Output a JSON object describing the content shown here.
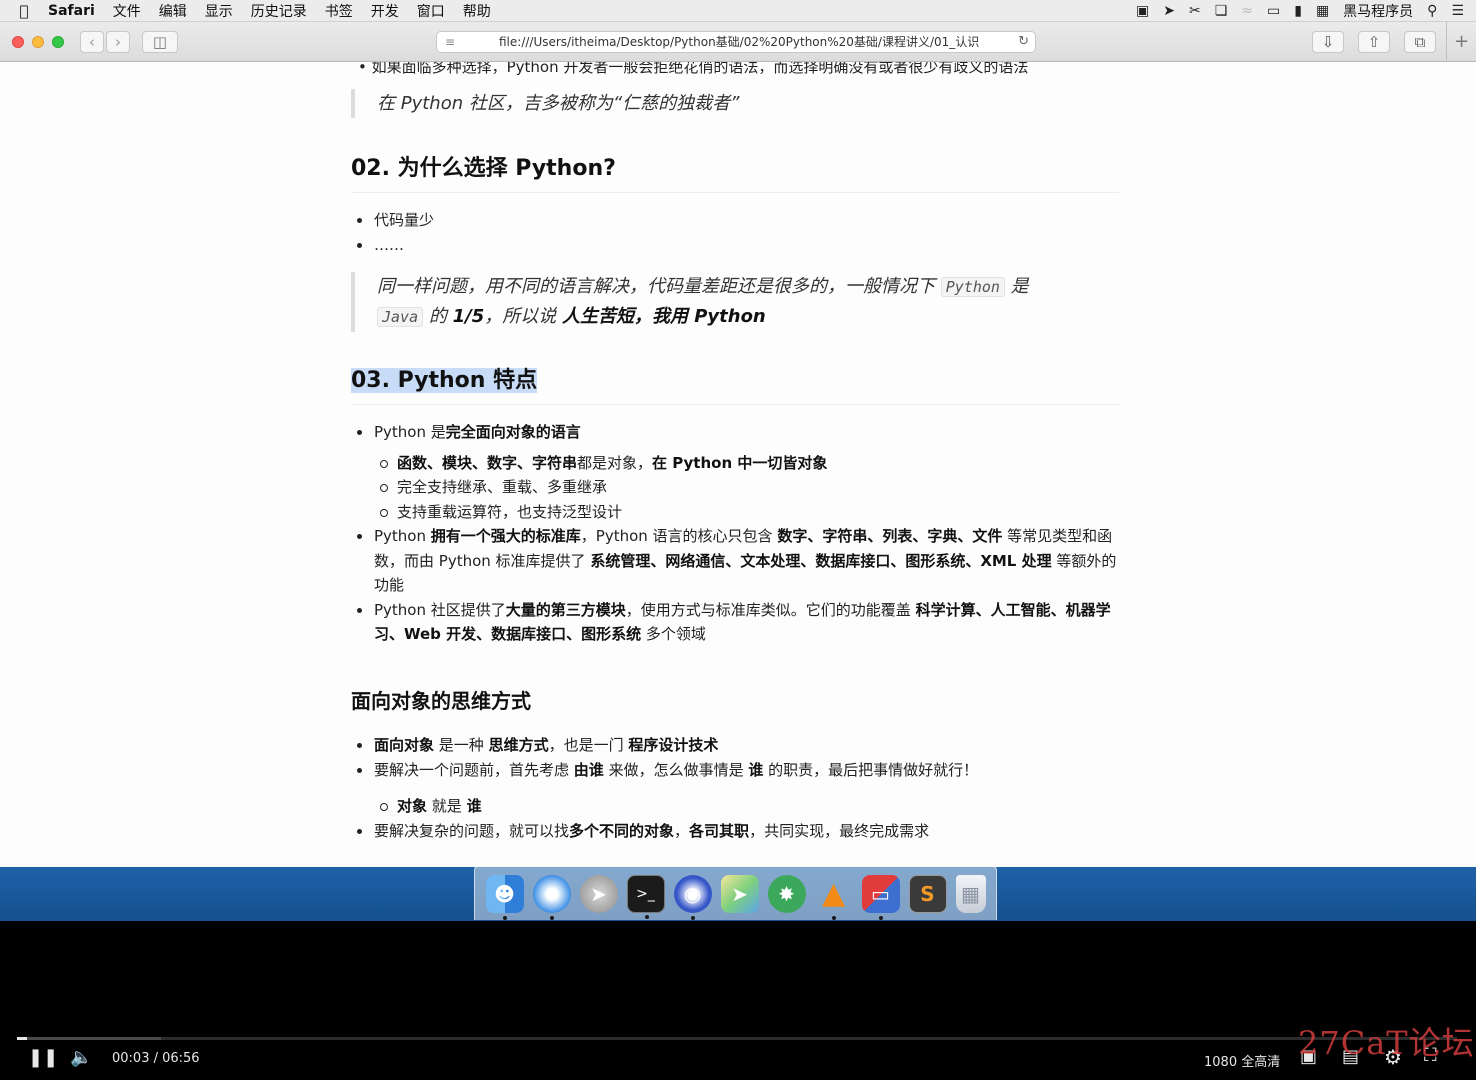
{
  "menubar": {
    "apple": "",
    "app_name": "Safari",
    "items": [
      "文件",
      "编辑",
      "显示",
      "历史记录",
      "书签",
      "开发",
      "窗口",
      "帮助"
    ],
    "user_name": "黑马程序员"
  },
  "browser": {
    "url": "file:///Users/itheima/Desktop/Python基础/02%20Python%20基础/课程讲义/01_认识",
    "new_tab": "+"
  },
  "doc": {
    "cut_line": "如果面临多种选择，Python 开发者一般会拒绝花俏的语法，而选择明确没有或者很少有歧义的语法",
    "quote1": "在 Python 社区，吉多被称为“仁慈的独裁者”",
    "h2_why": "02. 为什么选择 Python?",
    "why_items": [
      "代码量少",
      "……"
    ],
    "quote2": {
      "p1": "同一样问题，用不同的语言解决，代码量差距还是很多的，一般情况下",
      "code1": "Python",
      "p2": "是",
      "code2": "Java",
      "p3": "的",
      "b1": "1/5",
      "p4": "，所以说",
      "b2": "人生苦短，我用 Python"
    },
    "h2_features": "03. Python 特点",
    "f1": {
      "a": "Python 是",
      "b": "完全面向对象的语言"
    },
    "f1_sub1": {
      "b1": "函数、模块、数字、字符串",
      "a1": "都是对象，",
      "b2": "在 Python 中一切皆对象"
    },
    "f1_sub2": "完全支持继承、重载、多重继承",
    "f1_sub3": "支持重载运算符，也支持泛型设计",
    "f2": {
      "a": "Python ",
      "b1": "拥有一个强大的标准库",
      "c": "，Python 语言的核心只包含 ",
      "b2": "数字、字符串、列表、字典、文件",
      "d": " 等常见类型和函数，而由 Python 标准库提供了 ",
      "b3": "系统管理、网络通信、文本处理、数据库接口、图形系统、XML 处理",
      "e": " 等额外的功能"
    },
    "f3": {
      "a": "Python 社区提供了",
      "b1": "大量的第三方模块",
      "c": "，使用方式与标准库类似。它们的功能覆盖 ",
      "b2": "科学计算、人工智能、机器学习、Web 开发、数据库接口、图形系统",
      "d": " 多个领域"
    },
    "h3_oop": "面向对象的思维方式",
    "o1": {
      "b1": "面向对象",
      "a": " 是一种 ",
      "b2": "思维方式",
      "c": "，也是一门 ",
      "b3": "程序设计技术"
    },
    "o2": {
      "a": "要解决一个问题前，首先考虑 ",
      "b1": "由谁",
      "c": " 来做，怎么做事情是 ",
      "b2": "谁",
      "d": " 的职责，最后把事情做好就行！"
    },
    "o2_sub": {
      "b1": "对象",
      "a": " 就是 ",
      "b2": "谁"
    },
    "o3": {
      "a": "要解决复杂的问题，就可以找",
      "b1": "多个不同的对象",
      "c": "，",
      "b2": "各司其职",
      "d": "，共同实现，最终完成需求"
    }
  },
  "dock": {
    "icons": [
      "finder-icon",
      "safari-icon",
      "launchpad-icon",
      "terminal-icon",
      "screen-recorder-icon",
      "maps-icon",
      "xmind-icon",
      "vlc-icon",
      "parallels-icon",
      "sublime-text-icon",
      "trash-icon"
    ]
  },
  "player": {
    "time": "00:03 / 06:56",
    "progress": 0.007,
    "buffered": 0.1,
    "quality": "1080 全高清",
    "watermark": "27CaT论坛"
  }
}
